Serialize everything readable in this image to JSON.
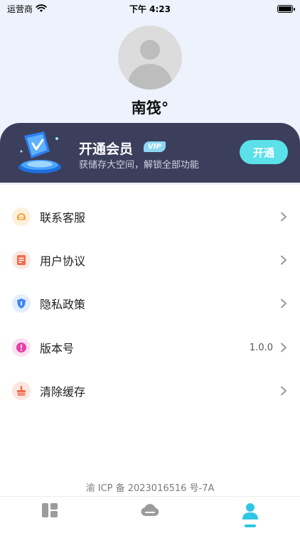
{
  "status_bar": {
    "carrier": "运营商",
    "time": "下午 4:23"
  },
  "profile": {
    "nickname": "南筏°"
  },
  "vip": {
    "title": "开通会员",
    "badge": "VIP",
    "subtitle": "获储存大空间，解锁全部功能",
    "button_label": "开通"
  },
  "menu": {
    "items": [
      {
        "label": "联系客服",
        "value": "",
        "icon": "headset-icon"
      },
      {
        "label": "用户协议",
        "value": "",
        "icon": "document-icon"
      },
      {
        "label": "隐私政策",
        "value": "",
        "icon": "shield-icon"
      },
      {
        "label": "版本号",
        "value": "1.0.0",
        "icon": "info-icon"
      },
      {
        "label": "清除缓存",
        "value": "",
        "icon": "broom-icon"
      }
    ]
  },
  "footer": {
    "icp": "渝 ICP 备 2023016516 号-7A"
  },
  "tabbar": {
    "tabs": [
      {
        "name": "dashboard-icon",
        "active": false
      },
      {
        "name": "cloud-icon",
        "active": false
      },
      {
        "name": "profile-icon",
        "active": true
      }
    ]
  },
  "colors": {
    "accent": "#5ce0ea",
    "vip_card": "#3b3f5c",
    "header_bg": "#eef2fc"
  }
}
